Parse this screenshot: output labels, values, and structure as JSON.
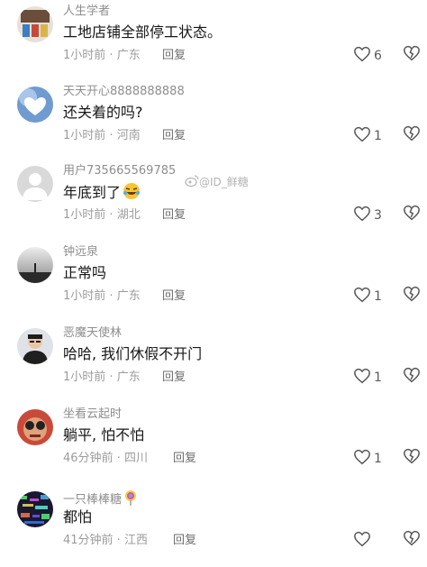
{
  "watermark": {
    "handle": "@ID_鲜糖",
    "icon": "weibo-icon"
  },
  "comments": [
    {
      "username": "人生学者",
      "text": "工地店铺全部停工状态。",
      "time": "1小时前",
      "location": "广东",
      "reply_label": "回复",
      "likes": "6"
    },
    {
      "username": "天天开心8888888888",
      "text": "还关着的吗?",
      "time": "1小时前",
      "location": "河南",
      "reply_label": "回复",
      "likes": "1"
    },
    {
      "username": "用户735665569785",
      "text": "年底到了",
      "emoji": "rolling-laughing-emoji",
      "time": "1小时前",
      "location": "湖北",
      "reply_label": "回复",
      "likes": "3"
    },
    {
      "username": "钟远泉",
      "text": "正常吗",
      "time": "1小时前",
      "location": "广东",
      "reply_label": "回复",
      "likes": "1"
    },
    {
      "username": "恶魔天使林",
      "text": "哈哈, 我们休假不开门",
      "time": "1小时前",
      "location": "广东",
      "reply_label": "回复",
      "likes": "1"
    },
    {
      "username": "坐看云起时",
      "text": "躺平, 怕不怕",
      "time": "46分钟前",
      "location": "四川",
      "reply_label": "回复",
      "likes": "1"
    },
    {
      "username": "一只棒棒糖",
      "username_emoji": "lollipop-emoji",
      "text": "都怕",
      "time": "41分钟前",
      "location": "江西",
      "reply_label": "回复",
      "likes": ""
    }
  ],
  "colors": {
    "meta_gray": "#9c9c9c",
    "text": "#161616",
    "icon": "#555555"
  }
}
